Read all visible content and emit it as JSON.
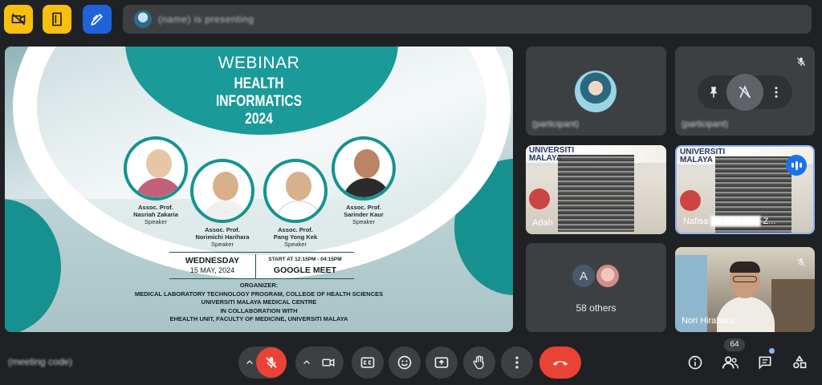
{
  "presenter": {
    "name": "(name) is presenting"
  },
  "slide": {
    "heading": "WEBINAR",
    "title_line1": "HEALTH",
    "title_line2": "INFORMATICS",
    "title_line3": "2024",
    "speakers": [
      {
        "title": "Assoc. Prof.",
        "name": "Nasriah Zakaria",
        "role": "Speaker"
      },
      {
        "title": "Assoc. Prof.",
        "name": "Norimichi Harihara",
        "role": "Speaker"
      },
      {
        "title": "Assoc. Prof.",
        "name": "Pang Yong Kek",
        "role": "Speaker"
      },
      {
        "title": "Assoc. Prof.",
        "name": "Sarinder Kaur",
        "role": "Speaker"
      }
    ],
    "day": "WEDNESDAY",
    "date": "15 MAY, 2024",
    "time": "START AT 12:15PM - 04:15PM",
    "platform": "GOOGLE MEET",
    "organizer_label": "ORGANIZER:",
    "organizer_line1": "MEDICAL LABORATORY TECHNOLOGY PROGRAM, COLLEGE OF HEALTH SCIENCES",
    "organizer_line2": "UNIVERSITI MALAYA MEDICAL CENTRE",
    "organizer_line3": "IN COLLABORATION WITH",
    "organizer_line4": "EHEALTH UNIT, FACULTY OF MEDICINE, UNIVERSITI MALAYA"
  },
  "participants": {
    "tile1_name": "(participant)",
    "tile2_name": "(participant)",
    "tile3_name": "Adah",
    "tile4_name": "Nafisa",
    "tile4_suffix": "Z...",
    "others_initial": "A",
    "others_label": "58 others",
    "tile6_name": "Nori Hirahara",
    "uni_text_line1": "UNIVERSITI",
    "uni_text_line2": "MALAYA"
  },
  "bottom_bar": {
    "meeting_code": "(meeting code)",
    "people_count": "64"
  },
  "colors": {
    "background": "#202124",
    "tile": "#3c4043",
    "danger": "#ea4335",
    "accent_blue": "#8ab4f8",
    "teal": "#1a9a98",
    "top_yellow": "#f9bf0e",
    "top_blue": "#1f63d8"
  },
  "icons": [
    "video-off-icon",
    "door-icon",
    "pen-icon",
    "mic-off-icon",
    "camera-icon",
    "captions-icon",
    "emoji-icon",
    "present-icon",
    "hand-icon",
    "more-icon",
    "end-call-icon",
    "info-icon",
    "people-icon",
    "chat-icon",
    "activities-icon",
    "pin-icon",
    "pause-icon",
    "audio-speaking-icon"
  ]
}
